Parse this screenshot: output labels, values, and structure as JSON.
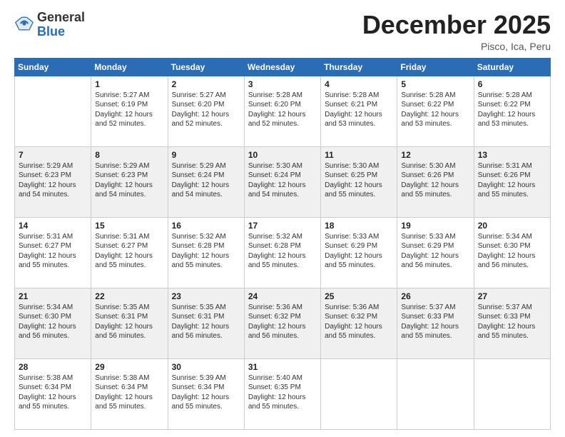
{
  "header": {
    "logo_general": "General",
    "logo_blue": "Blue",
    "month_title": "December 2025",
    "location": "Pisco, Ica, Peru"
  },
  "days_of_week": [
    "Sunday",
    "Monday",
    "Tuesday",
    "Wednesday",
    "Thursday",
    "Friday",
    "Saturday"
  ],
  "weeks": [
    [
      {
        "day": "",
        "sunrise": "",
        "sunset": "",
        "daylight": ""
      },
      {
        "day": "1",
        "sunrise": "Sunrise: 5:27 AM",
        "sunset": "Sunset: 6:19 PM",
        "daylight": "Daylight: 12 hours and 52 minutes."
      },
      {
        "day": "2",
        "sunrise": "Sunrise: 5:27 AM",
        "sunset": "Sunset: 6:20 PM",
        "daylight": "Daylight: 12 hours and 52 minutes."
      },
      {
        "day": "3",
        "sunrise": "Sunrise: 5:28 AM",
        "sunset": "Sunset: 6:20 PM",
        "daylight": "Daylight: 12 hours and 52 minutes."
      },
      {
        "day": "4",
        "sunrise": "Sunrise: 5:28 AM",
        "sunset": "Sunset: 6:21 PM",
        "daylight": "Daylight: 12 hours and 53 minutes."
      },
      {
        "day": "5",
        "sunrise": "Sunrise: 5:28 AM",
        "sunset": "Sunset: 6:22 PM",
        "daylight": "Daylight: 12 hours and 53 minutes."
      },
      {
        "day": "6",
        "sunrise": "Sunrise: 5:28 AM",
        "sunset": "Sunset: 6:22 PM",
        "daylight": "Daylight: 12 hours and 53 minutes."
      }
    ],
    [
      {
        "day": "7",
        "sunrise": "Sunrise: 5:29 AM",
        "sunset": "Sunset: 6:23 PM",
        "daylight": "Daylight: 12 hours and 54 minutes."
      },
      {
        "day": "8",
        "sunrise": "Sunrise: 5:29 AM",
        "sunset": "Sunset: 6:23 PM",
        "daylight": "Daylight: 12 hours and 54 minutes."
      },
      {
        "day": "9",
        "sunrise": "Sunrise: 5:29 AM",
        "sunset": "Sunset: 6:24 PM",
        "daylight": "Daylight: 12 hours and 54 minutes."
      },
      {
        "day": "10",
        "sunrise": "Sunrise: 5:30 AM",
        "sunset": "Sunset: 6:24 PM",
        "daylight": "Daylight: 12 hours and 54 minutes."
      },
      {
        "day": "11",
        "sunrise": "Sunrise: 5:30 AM",
        "sunset": "Sunset: 6:25 PM",
        "daylight": "Daylight: 12 hours and 55 minutes."
      },
      {
        "day": "12",
        "sunrise": "Sunrise: 5:30 AM",
        "sunset": "Sunset: 6:26 PM",
        "daylight": "Daylight: 12 hours and 55 minutes."
      },
      {
        "day": "13",
        "sunrise": "Sunrise: 5:31 AM",
        "sunset": "Sunset: 6:26 PM",
        "daylight": "Daylight: 12 hours and 55 minutes."
      }
    ],
    [
      {
        "day": "14",
        "sunrise": "Sunrise: 5:31 AM",
        "sunset": "Sunset: 6:27 PM",
        "daylight": "Daylight: 12 hours and 55 minutes."
      },
      {
        "day": "15",
        "sunrise": "Sunrise: 5:31 AM",
        "sunset": "Sunset: 6:27 PM",
        "daylight": "Daylight: 12 hours and 55 minutes."
      },
      {
        "day": "16",
        "sunrise": "Sunrise: 5:32 AM",
        "sunset": "Sunset: 6:28 PM",
        "daylight": "Daylight: 12 hours and 55 minutes."
      },
      {
        "day": "17",
        "sunrise": "Sunrise: 5:32 AM",
        "sunset": "Sunset: 6:28 PM",
        "daylight": "Daylight: 12 hours and 55 minutes."
      },
      {
        "day": "18",
        "sunrise": "Sunrise: 5:33 AM",
        "sunset": "Sunset: 6:29 PM",
        "daylight": "Daylight: 12 hours and 55 minutes."
      },
      {
        "day": "19",
        "sunrise": "Sunrise: 5:33 AM",
        "sunset": "Sunset: 6:29 PM",
        "daylight": "Daylight: 12 hours and 56 minutes."
      },
      {
        "day": "20",
        "sunrise": "Sunrise: 5:34 AM",
        "sunset": "Sunset: 6:30 PM",
        "daylight": "Daylight: 12 hours and 56 minutes."
      }
    ],
    [
      {
        "day": "21",
        "sunrise": "Sunrise: 5:34 AM",
        "sunset": "Sunset: 6:30 PM",
        "daylight": "Daylight: 12 hours and 56 minutes."
      },
      {
        "day": "22",
        "sunrise": "Sunrise: 5:35 AM",
        "sunset": "Sunset: 6:31 PM",
        "daylight": "Daylight: 12 hours and 56 minutes."
      },
      {
        "day": "23",
        "sunrise": "Sunrise: 5:35 AM",
        "sunset": "Sunset: 6:31 PM",
        "daylight": "Daylight: 12 hours and 56 minutes."
      },
      {
        "day": "24",
        "sunrise": "Sunrise: 5:36 AM",
        "sunset": "Sunset: 6:32 PM",
        "daylight": "Daylight: 12 hours and 56 minutes."
      },
      {
        "day": "25",
        "sunrise": "Sunrise: 5:36 AM",
        "sunset": "Sunset: 6:32 PM",
        "daylight": "Daylight: 12 hours and 55 minutes."
      },
      {
        "day": "26",
        "sunrise": "Sunrise: 5:37 AM",
        "sunset": "Sunset: 6:33 PM",
        "daylight": "Daylight: 12 hours and 55 minutes."
      },
      {
        "day": "27",
        "sunrise": "Sunrise: 5:37 AM",
        "sunset": "Sunset: 6:33 PM",
        "daylight": "Daylight: 12 hours and 55 minutes."
      }
    ],
    [
      {
        "day": "28",
        "sunrise": "Sunrise: 5:38 AM",
        "sunset": "Sunset: 6:34 PM",
        "daylight": "Daylight: 12 hours and 55 minutes."
      },
      {
        "day": "29",
        "sunrise": "Sunrise: 5:38 AM",
        "sunset": "Sunset: 6:34 PM",
        "daylight": "Daylight: 12 hours and 55 minutes."
      },
      {
        "day": "30",
        "sunrise": "Sunrise: 5:39 AM",
        "sunset": "Sunset: 6:34 PM",
        "daylight": "Daylight: 12 hours and 55 minutes."
      },
      {
        "day": "31",
        "sunrise": "Sunrise: 5:40 AM",
        "sunset": "Sunset: 6:35 PM",
        "daylight": "Daylight: 12 hours and 55 minutes."
      },
      {
        "day": "",
        "sunrise": "",
        "sunset": "",
        "daylight": ""
      },
      {
        "day": "",
        "sunrise": "",
        "sunset": "",
        "daylight": ""
      },
      {
        "day": "",
        "sunrise": "",
        "sunset": "",
        "daylight": ""
      }
    ]
  ]
}
